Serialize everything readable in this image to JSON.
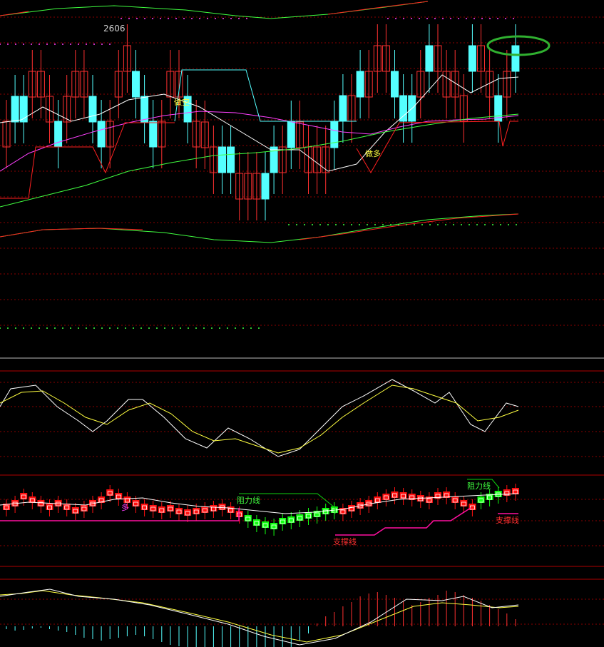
{
  "colors": {
    "bg": "#000000",
    "up": "#ff3030",
    "down": "#54ffff",
    "ma_white": "#ffffff",
    "ma_magenta": "#ff40ff",
    "ma_green": "#40ff40",
    "band_red": "#ff2020",
    "band_green": "#40ff40",
    "grid": "#8b0000",
    "stop_red": "#ff2020",
    "stop_cyan": "#54ffff",
    "kdj_white": "#ffffff",
    "kdj_yellow": "#ffff40",
    "bar_red": "#ff1010",
    "bar_green": "#10ff10",
    "resist": "#10d010",
    "support": "#ff10a0",
    "annot_yellow": "#ffff40",
    "annot_green": "#40ff40",
    "annot_red": "#ff3030",
    "highlight": "#30b030"
  },
  "main_panel": {
    "price_label": "2606",
    "annot_short": "做空",
    "annot_long": "做多",
    "highlight_marker": "green-ellipse"
  },
  "panel3": {
    "annot_duo": "多",
    "resist_label_1": "阻力线",
    "resist_label_2": "阻力线",
    "support_label_1": "支撑线",
    "support_label_2": "支撑线"
  },
  "chart_data": {
    "type": "candlestick",
    "title": "",
    "xlabel": "",
    "ylabel": "",
    "candles_bias_series": [
      "up",
      "down",
      "down",
      "up",
      "up",
      "up",
      "down",
      "up",
      "up",
      "up",
      "down",
      "down",
      "up",
      "up",
      "up",
      "down",
      "down",
      "down",
      "up",
      "up",
      "up",
      "down",
      "up",
      "up",
      "up",
      "down",
      "down",
      "up",
      "up",
      "up",
      "down",
      "down",
      "up",
      "down",
      "up",
      "up",
      "up",
      "up",
      "down",
      "down",
      "up",
      "down",
      "up",
      "up",
      "up",
      "down",
      "down",
      "down",
      "up",
      "down",
      "up",
      "up",
      "up",
      "up",
      "down",
      "up",
      "up",
      "down",
      "up",
      "down",
      "up",
      "down",
      "up",
      "down",
      "up",
      "down",
      "up",
      "up",
      "up",
      "up",
      "up",
      "down",
      "up",
      "down"
    ],
    "panels": [
      "price",
      "oscillator",
      "trend-bars",
      "macd"
    ]
  }
}
